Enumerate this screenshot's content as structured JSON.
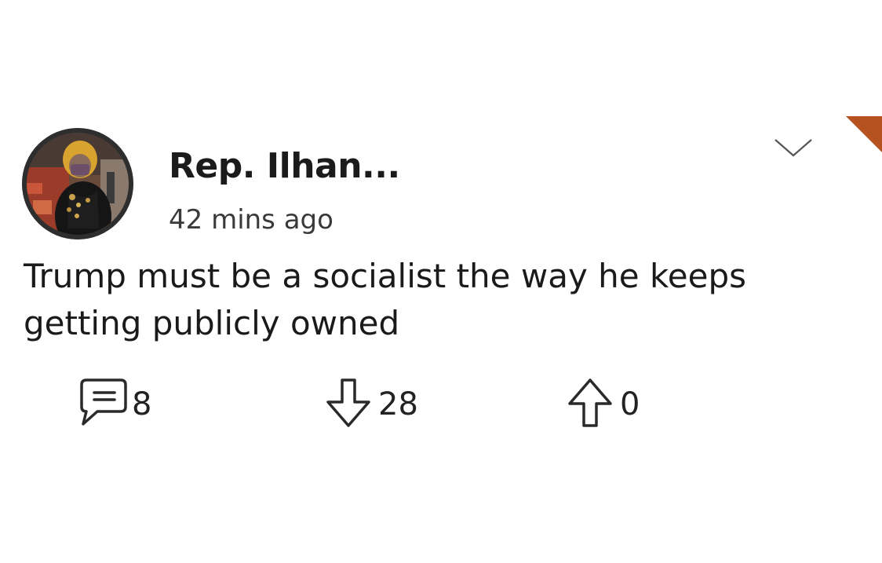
{
  "post": {
    "author": "Rep. Ilhan...",
    "timestamp": "42 mins ago",
    "text": "Trump must be a socialist the way he keeps getting publicly owned",
    "menu_icon": "chevron-down-icon",
    "accent_color": "#b5521f"
  },
  "actions": {
    "comments": {
      "icon": "comment-icon",
      "count": "8"
    },
    "downvotes": {
      "icon": "arrow-down-icon",
      "count": "28"
    },
    "upvotes": {
      "icon": "arrow-up-icon",
      "count": "0"
    }
  }
}
